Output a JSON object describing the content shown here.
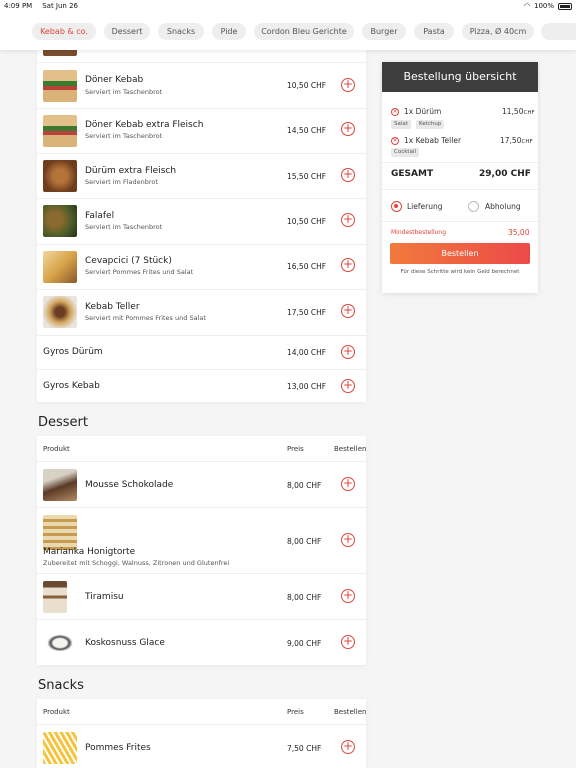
{
  "status_bar": {
    "time": "4:09 PM",
    "date": "Sat Jun 26",
    "battery": "100%"
  },
  "categories": [
    "Kebab & co.",
    "Dessert",
    "Snacks",
    "Pide",
    "Cordon Bleu Gerichte",
    "Burger",
    "Pasta",
    "Pizza, Ø 40cm"
  ],
  "kebab_items": [
    {
      "name": "Döner Kebab",
      "desc": "Serviert im Taschenbrot",
      "price": "10,50 CHF"
    },
    {
      "name": "Döner Kebab extra Fleisch",
      "desc": "Serviert im Taschenbrot",
      "price": "14,50 CHF"
    },
    {
      "name": "Dürüm extra Fleisch",
      "desc": "Serviert im Fladenbrot",
      "price": "15,50 CHF"
    },
    {
      "name": "Falafel",
      "desc": "Serviert im Taschenbrot",
      "price": "10,50 CHF"
    },
    {
      "name": "Cevapcici (7 Stück)",
      "desc": "Serviert Pommes Frites und Salat",
      "price": "16,50 CHF"
    },
    {
      "name": "Kebab Teller",
      "desc": "Serviert mit Pommes Frites und Salat",
      "price": "17,50 CHF"
    },
    {
      "name": "Gyros Dürüm",
      "price": "14,00 CHF"
    },
    {
      "name": "Gyros Kebab",
      "price": "13,00 CHF"
    }
  ],
  "dessert": {
    "title": "Dessert",
    "col_product": "Produkt",
    "col_price": "Preis",
    "col_order": "Bestellen",
    "items": [
      {
        "name": "Mousse Schokolade",
        "price": "8,00 CHF"
      },
      {
        "name": "Marianka Honigtorte",
        "desc": "Zubereitet mit Schoggi, Walnuss, Zitronen und Glutenfrei",
        "price": "8,00 CHF"
      },
      {
        "name": "Tiramisu",
        "price": "8,00 CHF"
      },
      {
        "name": "Koskosnuss Glace",
        "price": "9,00 CHF"
      }
    ]
  },
  "snacks": {
    "title": "Snacks",
    "col_product": "Produkt",
    "col_price": "Preis",
    "col_order": "Bestellen",
    "items": [
      {
        "name": "Pommes Frites",
        "price": "7,50 CHF"
      }
    ]
  },
  "order": {
    "title": "Bestellung übersicht",
    "items": [
      {
        "label": "1x Dürüm",
        "price": "11,50",
        "currency": "CHF",
        "extras": [
          "Salat",
          "Ketchup"
        ]
      },
      {
        "label": "1x Kebab Teller",
        "price": "17,50",
        "currency": "CHF",
        "extras": [
          "Cocktail"
        ]
      }
    ],
    "total_label": "GESAMT",
    "total": "29,00 CHF",
    "delivery": "Lieferung",
    "pickup": "Abholung",
    "min_label": "Mindestbestellung",
    "min_value": "35,00",
    "button": "Bestellen",
    "note": "Für diese Schritte wird kein Geld berechnet"
  },
  "colors": {
    "accent": "#e0443b",
    "header_dark": "#3e3e3e"
  }
}
